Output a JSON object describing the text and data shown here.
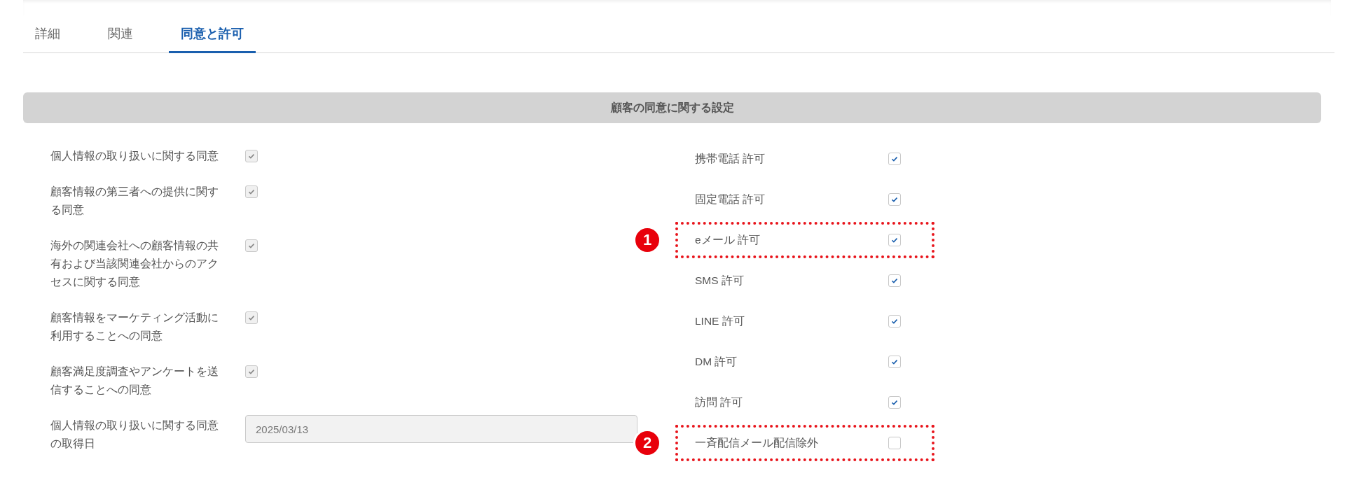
{
  "tabs": [
    {
      "label": "詳細",
      "selected": false
    },
    {
      "label": "関連",
      "selected": false
    },
    {
      "label": "同意と許可",
      "selected": true
    }
  ],
  "section": {
    "title": "顧客の同意に関する設定",
    "left_fields": [
      {
        "kind": "checkbox",
        "label": "個人情報の取り扱いに関する同意",
        "checked": true,
        "disabled": true
      },
      {
        "kind": "checkbox",
        "label": "顧客情報の第三者への提供に関する同意",
        "checked": true,
        "disabled": true
      },
      {
        "kind": "checkbox",
        "label": "海外の関連会社への顧客情報の共有および当該関連会社からのアクセスに関する同意",
        "checked": true,
        "disabled": true
      },
      {
        "kind": "checkbox",
        "label": "顧客情報をマーケティング活動に利用することへの同意",
        "checked": true,
        "disabled": true
      },
      {
        "kind": "checkbox",
        "label": "顧客満足度調査やアンケートを送信することへの同意",
        "checked": true,
        "disabled": true
      },
      {
        "kind": "date",
        "label": "個人情報の取り扱いに関する同意の取得日",
        "value": "2025/03/13",
        "disabled": true
      }
    ],
    "right_fields": [
      {
        "label": "携帯電話 許可",
        "checked": true,
        "highlighted": false
      },
      {
        "label": "固定電話 許可",
        "checked": true,
        "highlighted": false
      },
      {
        "label": "eメール 許可",
        "checked": true,
        "highlighted": true,
        "badge": "1"
      },
      {
        "label": "SMS 許可",
        "checked": true,
        "highlighted": false
      },
      {
        "label": "LINE 許可",
        "checked": true,
        "highlighted": false
      },
      {
        "label": "DM 許可",
        "checked": true,
        "highlighted": false
      },
      {
        "label": "訪問 許可",
        "checked": true,
        "highlighted": false
      },
      {
        "label": "一斉配信メール配信除外",
        "checked": false,
        "highlighted": true,
        "badge": "2"
      }
    ]
  }
}
